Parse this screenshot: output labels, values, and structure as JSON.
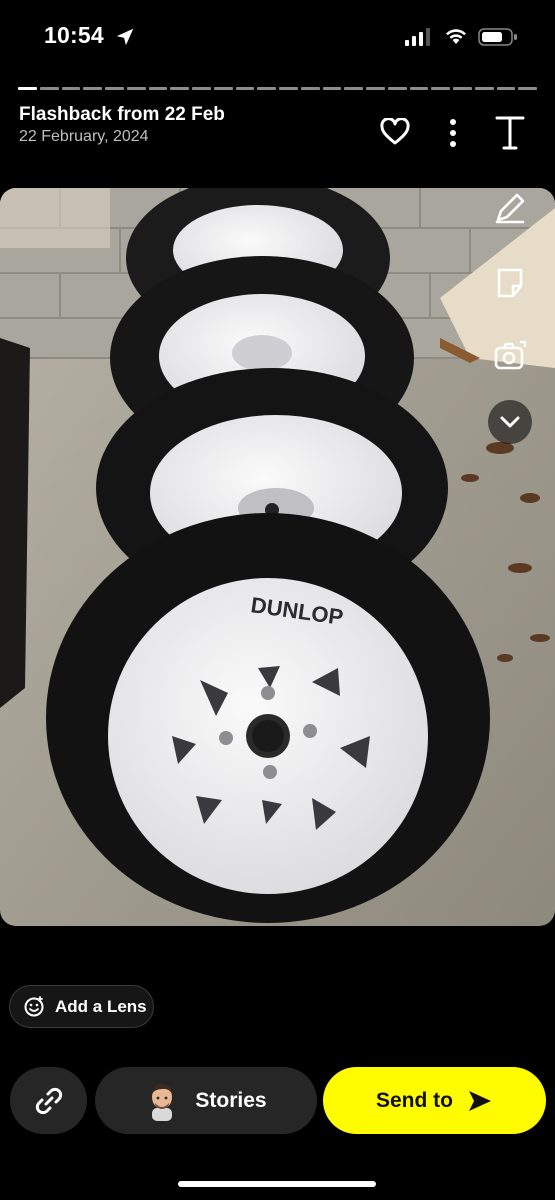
{
  "status_bar": {
    "time": "10:54"
  },
  "header": {
    "title": "Flashback from 22 Feb",
    "date": "22 February, 2024",
    "progress_segments_total": 24,
    "progress_segments_done": 1
  },
  "photo": {
    "description_icon": "tyres-photo",
    "tyre_brand_text": "DUNLOP"
  },
  "tools": {
    "right": [
      "pencil-icon",
      "sticker-icon",
      "camera-flip-icon",
      "chevron-down-icon"
    ]
  },
  "lens": {
    "label": "Add a Lens"
  },
  "bottom_bar": {
    "stories_label": "Stories",
    "send_label": "Send to"
  },
  "colors": {
    "background": "#000000",
    "accent_yellow": "#fffc00",
    "button_dark": "#262626"
  }
}
